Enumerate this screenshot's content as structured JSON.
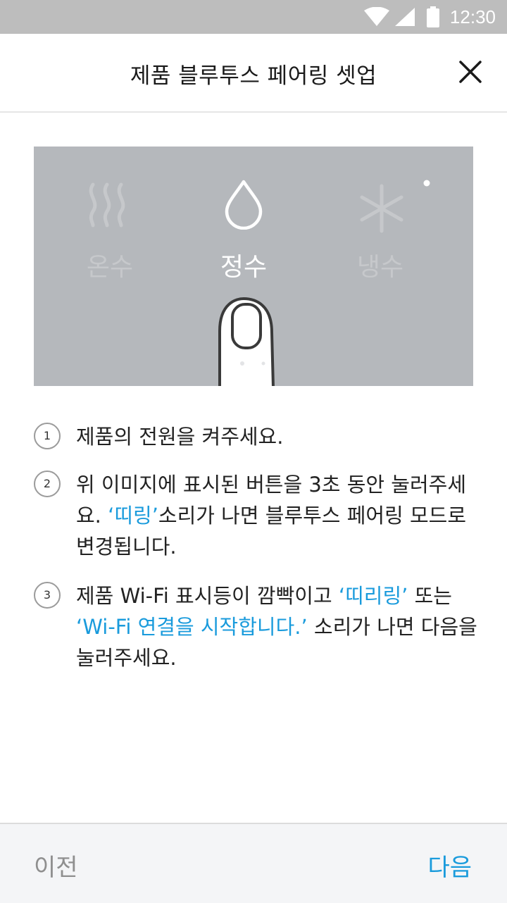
{
  "status_bar": {
    "time": "12:30",
    "icons": [
      "wifi-icon",
      "cell-signal-icon",
      "battery-icon"
    ]
  },
  "header": {
    "title": "제품 블루투스 페어링 셋업",
    "close_icon": "close-icon"
  },
  "illustration": {
    "labels": {
      "warm": "온수",
      "purified": "정수",
      "cold": "냉수"
    },
    "icons": [
      "hot-water-icon",
      "water-drop-icon",
      "snowflake-icon",
      "finger-press-icon"
    ]
  },
  "steps": [
    {
      "number": "1",
      "text": "제품의 전원을 켜주세요."
    },
    {
      "number": "2",
      "part1": "위 이미지에 표시된 버튼을 3초 동안 눌러주세요. ",
      "highlight1": "‘띠링’",
      "part2": "소리가 나면 블루투스 페어링 모드로 변경됩니다."
    },
    {
      "number": "3",
      "part1": "제품 Wi-Fi 표시등이 깜빡이고 ",
      "highlight1": "‘띠리링’",
      "part2": " 또는 ",
      "highlight2": "‘Wi-Fi 연결을 시작합니다.’",
      "part3": " 소리가 나면 다음을 눌러주세요."
    }
  ],
  "footer": {
    "prev_label": "이전",
    "next_label": "다음"
  },
  "colors": {
    "accent": "#1a9bdc",
    "status_bar": "#bdbdbd",
    "illustration_bg": "#b5b8bc",
    "footer_bg": "#f4f5f7"
  }
}
